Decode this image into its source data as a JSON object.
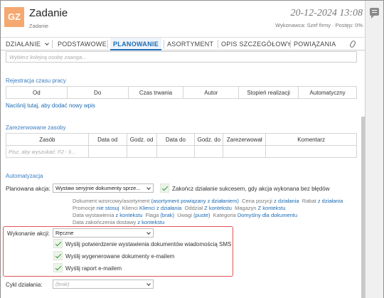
{
  "header": {
    "avatar_initials": "GZ",
    "title": "Zadanie",
    "subtitle": "Zadanie",
    "date": "20-12-2024 13:08",
    "meta": "Wykonawca: Szef firmy · Postęp: 0%"
  },
  "tabs": [
    {
      "label": "DZIAŁANIE",
      "has_chevron": true
    },
    {
      "label": "PODSTAWOWE"
    },
    {
      "label": "PLANOWANIE",
      "active": true
    },
    {
      "label": "ASORTYMENT"
    },
    {
      "label": "OPIS SZCZEGÓŁOWY"
    },
    {
      "label": "POWIĄZANIA"
    }
  ],
  "person_input": {
    "placeholder": "Wybierz kolejną osobę zaanga..."
  },
  "time_registration": {
    "title": "Rejestracja czasu pracy",
    "columns": [
      "Od",
      "Do",
      "Czas trwania",
      "Autor",
      "Stopień realizacji",
      "Automatyczny"
    ],
    "add_link": "Naciśnij tutaj, aby dodać nowy wpis"
  },
  "reserved": {
    "title": "Zarezerwowane zasoby",
    "columns": [
      "Zasób",
      "Data od",
      "Godz. od",
      "Data do",
      "Godz. do",
      "Zarezerwował",
      "Komentarz"
    ],
    "search_placeholder": "Pisz, aby wyszukać: F2 - li..."
  },
  "automation": {
    "title": "Automatyzacja",
    "planned_label": "Planowana akcja:",
    "planned_value": "Wystaw seryjnie dokumenty sprze...",
    "finish_label": "Zakończ działanie sukcesem, gdy akcja wykonana bez błędów",
    "details": {
      "doc_label": "Dokument wzorcowy/asortyment",
      "doc_value": "(asortyment powiązany z działaniem)",
      "price_label": "Cena pozycji",
      "price_value": "z działania",
      "discount_label": "Rabat",
      "discount_value": "z działania",
      "promo_label": "Promocje",
      "promo_value": "nie stosuj",
      "clients_label": "Klienci",
      "clients_value": "Klienci z działania",
      "dept_label": "Oddział",
      "dept_value": "Z kontekstu",
      "warehouse_label": "Magazyn",
      "warehouse_value": "Z kontekstu",
      "issue_label": "Data wystawienia",
      "issue_value": "z kontekstu",
      "flag_label": "Flaga",
      "flag_value": "(brak)",
      "notes_label": "Uwagi",
      "notes_value": "(puste)",
      "category_label": "Kategoria",
      "category_value": "Domyślny dla dokumentu",
      "delivery_label": "Data zakończenia dostawy",
      "delivery_value": "z kontekstu"
    },
    "execution_label": "Wykonanie akcji:",
    "execution_value": "Ręczne",
    "options": [
      "Wyślij potwierdzenie wystawienia dokumentów wiadomością SMS",
      "Wyślij wygenerowane dokumenty e-mailem",
      "Wyślij raport e-mailem"
    ],
    "cycle_label": "Cykl działania:",
    "cycle_value": "(brak)"
  }
}
